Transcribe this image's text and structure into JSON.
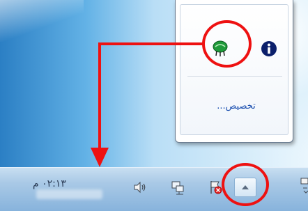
{
  "taskbar": {
    "clock_time": "٠٢:١٣ م"
  },
  "tray_icons": [
    "speaker-icon",
    "network-icon",
    "action-center-flag-icon",
    "show-hidden-icons-chevron-icon"
  ],
  "popup": {
    "customize_label": "تخصيص...",
    "icons": [
      "green-security-shield-icon",
      "info-icon"
    ]
  },
  "colors": {
    "annotation_red": "#ee1111",
    "link_blue": "#1b4fb0",
    "taskbar": "#a9c9e6"
  }
}
